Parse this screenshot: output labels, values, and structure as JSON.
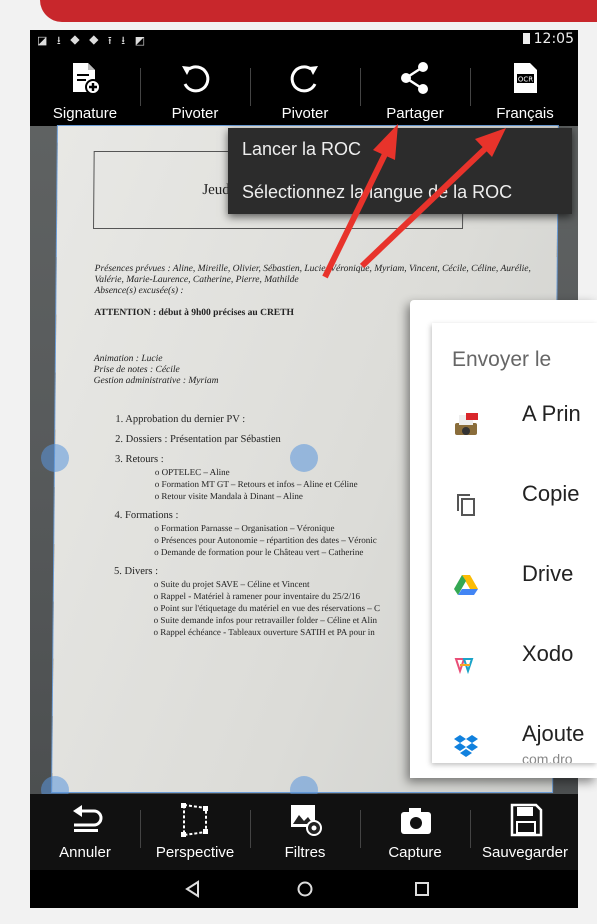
{
  "status": {
    "time": "12:05",
    "icons": "◪ ⭳ ⯁ ⯁ ⭱ ⭳ ◩"
  },
  "toolbar": {
    "signature": "Signature",
    "rotate_left": "Pivoter",
    "rotate_right": "Pivoter",
    "share": "Partager",
    "ocr_language": "Français"
  },
  "ocr_menu": {
    "items": [
      "Lancer la ROC",
      "Sélectionnez la langue de la ROC"
    ]
  },
  "document": {
    "header_text": "Jeud",
    "presences": "Présences prévues : Aline, Mireille, Olivier, Sébastien, Lucie, Véronique, Myriam, Vincent, Cécile, Céline, Aurélie, Valérie, Marie-Laurence, Catherine, Pierre, Mathilde",
    "absences": "Absence(s) excusée(s) :",
    "attention": "ATTENTION : début à 9h00 précises au CRETH",
    "animation": "Animation : Lucie",
    "notes": "Prise de notes : Cécile",
    "gestion": "Gestion administrative : Myriam",
    "items": [
      "1.  Approbation du dernier PV :",
      "2.  Dossiers :  Présentation par Sébastien",
      "3.  Retours :",
      "o  OPTELEC – Aline",
      "o  Formation MT GT – Retours et infos – Aline et Céline",
      "o  Retour visite Mandala à Dinant – Aline",
      "4.  Formations :",
      "o  Formation Parnasse – Organisation – Véronique",
      "o  Présences pour Autonomie – répartition des dates – Véronic",
      "o  Demande de formation pour le Château vert – Catherine",
      "5.  Divers :",
      "o  Suite du projet SAVE – Céline et Vincent",
      "o  Rappel - Matériel à ramener pour inventaire du 25/2/16",
      "o  Point sur l'étiquetage du matériel en vue des réservations – C",
      "o  Suite demande infos pour retravailler folder – Céline et Alin",
      "o  Rappel échéance - Tableaux ouverture SATIH et PA pour in"
    ]
  },
  "share_sheet": {
    "title": "Envoyer le",
    "apps": [
      {
        "name": "A Prin",
        "package": "",
        "icon": "printer-pdf-icon"
      },
      {
        "name": "Copie",
        "package": "",
        "icon": "copy-icon"
      },
      {
        "name": "Drive",
        "package": "",
        "icon": "google-drive-icon"
      },
      {
        "name": "Xodo",
        "package": "",
        "icon": "xodo-icon"
      },
      {
        "name": "Ajoute",
        "package": "com.dro",
        "icon": "dropbox-icon"
      }
    ]
  },
  "bottom_bar": {
    "undo": "Annuler",
    "perspective": "Perspective",
    "filters": "Filtres",
    "capture": "Capture",
    "save": "Sauvegarder"
  },
  "colors": {
    "banner": "#c8272c",
    "arrow": "#e8332b",
    "handle": "#5a96dc"
  }
}
